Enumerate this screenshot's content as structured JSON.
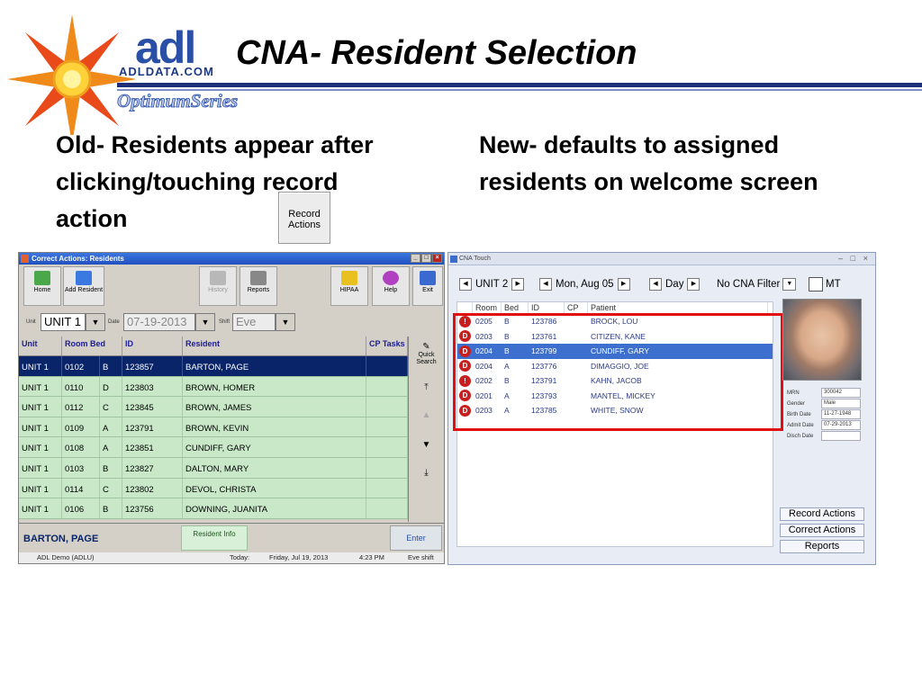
{
  "slide": {
    "title": "CNA- Resident Selection",
    "logo_text": "adl",
    "logo_domain": "ADLDATA.COM",
    "logo_series": "OptimumSeries",
    "old_text": "Old- Residents appear after clicking/touching record action",
    "new_text": "New- defaults to assigned residents on welcome screen",
    "inline_button": "Record Actions"
  },
  "colors": {
    "accent": "#1e2f7a",
    "highlight_box": "#e01010",
    "grid_green": "#c8e8c8",
    "selected_row": "#0a246a"
  },
  "old_window": {
    "title": "Correct Actions: Residents",
    "toolbar": [
      {
        "label": "Home",
        "icon": "house-icon"
      },
      {
        "label": "Add Resident",
        "icon": "plus-icon"
      },
      {
        "label": "History",
        "icon": "history-icon"
      },
      {
        "label": "Reports",
        "icon": "printer-icon"
      },
      {
        "label": "HIPAA",
        "icon": "key-icon"
      },
      {
        "label": "Help",
        "icon": "help-icon"
      },
      {
        "label": "Exit",
        "icon": "exit-door-icon"
      }
    ],
    "filters": {
      "unit_label": "Unit",
      "unit_value": "UNIT 1",
      "date_label": "Date",
      "date_value": "07-19-2013",
      "shift_label": "Shift",
      "shift_value": "Eve"
    },
    "columns": [
      "Unit",
      "Room Bed",
      "ID",
      "Resident",
      "CP Tasks"
    ],
    "rows": [
      {
        "unit": "UNIT 1",
        "room": "0102",
        "bed": "B",
        "id": "123857",
        "resident": "BARTON, PAGE",
        "selected": true
      },
      {
        "unit": "UNIT 1",
        "room": "0110",
        "bed": "D",
        "id": "123803",
        "resident": "BROWN, HOMER"
      },
      {
        "unit": "UNIT 1",
        "room": "0112",
        "bed": "C",
        "id": "123845",
        "resident": "BROWN, JAMES"
      },
      {
        "unit": "UNIT 1",
        "room": "0109",
        "bed": "A",
        "id": "123791",
        "resident": "BROWN, KEVIN"
      },
      {
        "unit": "UNIT 1",
        "room": "0108",
        "bed": "A",
        "id": "123851",
        "resident": "CUNDIFF, GARY"
      },
      {
        "unit": "UNIT 1",
        "room": "0103",
        "bed": "B",
        "id": "123827",
        "resident": "DALTON, MARY"
      },
      {
        "unit": "UNIT 1",
        "room": "0114",
        "bed": "C",
        "id": "123802",
        "resident": "DEVOL, CHRISTA"
      },
      {
        "unit": "UNIT 1",
        "room": "0106",
        "bed": "B",
        "id": "123756",
        "resident": "DOWNING, JUANITA"
      }
    ],
    "side": {
      "quick_search": "Quick Search"
    },
    "footer": {
      "selected_resident": "BARTON, PAGE",
      "resident_info": "Resident Info",
      "enter": "Enter"
    },
    "status": {
      "facility": "ADL Demo (ADLU)",
      "today_label": "Today:",
      "date": "Friday, Jul 19, 2013",
      "time": "4:23 PM",
      "shift": "Eve shift"
    }
  },
  "new_window": {
    "title": "CNA Touch",
    "filters": {
      "unit": "UNIT 2",
      "date": "Mon, Aug 05",
      "range": "Day",
      "cna_filter": "No CNA Filter",
      "mt_label": "MT"
    },
    "columns": [
      "Room",
      "Bed",
      "ID",
      "CP",
      "Patient"
    ],
    "rows": [
      {
        "status": "!",
        "room": "0205",
        "bed": "B",
        "id": "123786",
        "cp": "",
        "patient": "BROCK, LOU"
      },
      {
        "status": "D",
        "room": "0203",
        "bed": "B",
        "id": "123761",
        "cp": "",
        "patient": "CITIZEN, KANE"
      },
      {
        "status": "D",
        "room": "0204",
        "bed": "B",
        "id": "123799",
        "cp": "",
        "patient": "CUNDIFF, GARY",
        "selected": true
      },
      {
        "status": "D",
        "room": "0204",
        "bed": "A",
        "id": "123776",
        "cp": "",
        "patient": "DIMAGGIO, JOE"
      },
      {
        "status": "!",
        "room": "0202",
        "bed": "B",
        "id": "123791",
        "cp": "",
        "patient": "KAHN, JACOB"
      },
      {
        "status": "D",
        "room": "0201",
        "bed": "A",
        "id": "123793",
        "cp": "",
        "patient": "MANTEL, MICKEY"
      },
      {
        "status": "D",
        "room": "0203",
        "bed": "A",
        "id": "123785",
        "cp": "",
        "patient": "WHITE, SNOW"
      }
    ],
    "info": [
      {
        "label": "MRN",
        "value": "300042"
      },
      {
        "label": "Gender",
        "value": "Male"
      },
      {
        "label": "Birth Date",
        "value": "11-27-1948"
      },
      {
        "label": "Admit Date",
        "value": "07-29-2013"
      },
      {
        "label": "Disch Date",
        "value": ""
      }
    ],
    "buttons": {
      "record": "Record Actions",
      "correct": "Correct Actions",
      "reports": "Reports"
    }
  }
}
